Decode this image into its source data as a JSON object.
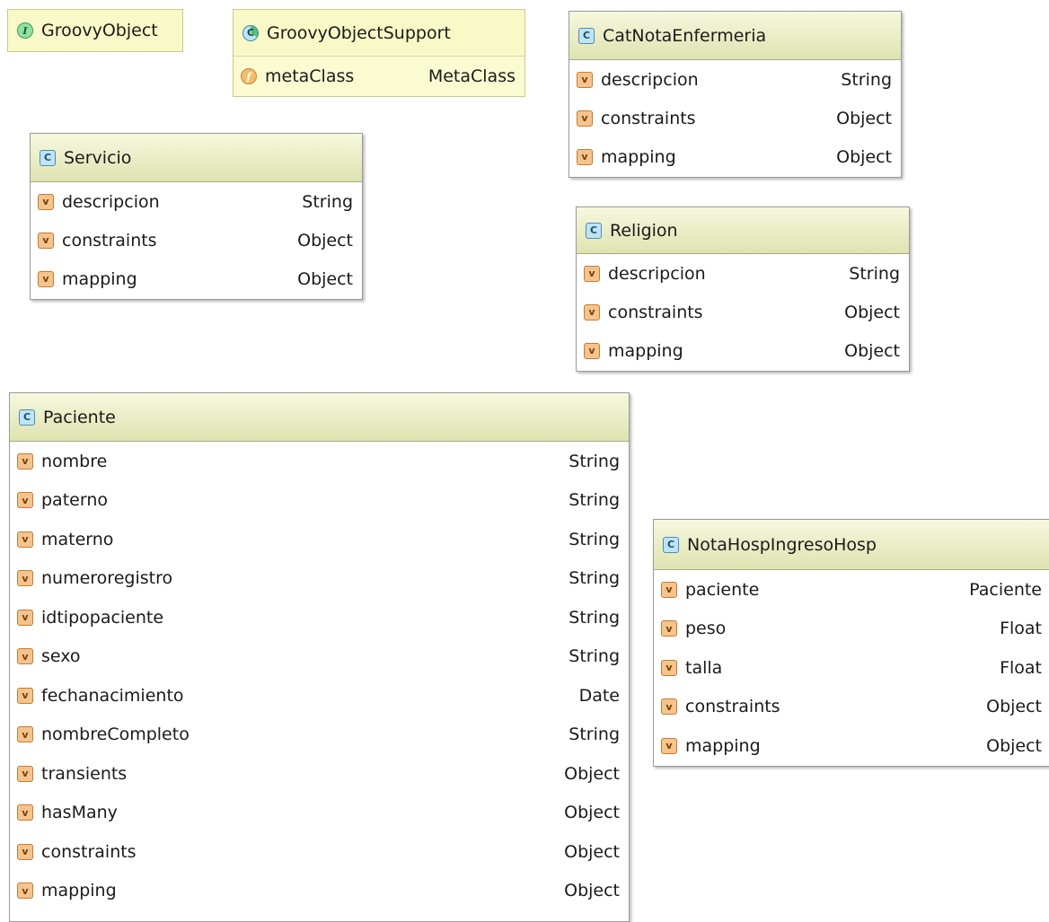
{
  "colors": {
    "header_top": "#f6f8df",
    "header_bottom": "#dfe3b0",
    "class_icon": "#bfe4f5",
    "field_icon": "#f4c48e",
    "interface_icon": "#8fe2a2",
    "yellow_box": "#fbfbd2"
  },
  "icons": {
    "class": "C",
    "field": "v",
    "interface": "I",
    "property": "f",
    "abstract_class": "C"
  },
  "boxes": {
    "groovyObject": {
      "name": "GroovyObject",
      "kind": "interface"
    },
    "groovyObjectSupport": {
      "name": "GroovyObjectSupport",
      "kind": "abstract-class",
      "fields": [
        {
          "name": "metaClass",
          "type": "MetaClass"
        }
      ]
    },
    "catNotaEnfermeria": {
      "name": "CatNotaEnfermeria",
      "fields": [
        {
          "name": "descripcion",
          "type": "String"
        },
        {
          "name": "constraints",
          "type": "Object"
        },
        {
          "name": "mapping",
          "type": "Object"
        }
      ]
    },
    "servicio": {
      "name": "Servicio",
      "fields": [
        {
          "name": "descripcion",
          "type": "String"
        },
        {
          "name": "constraints",
          "type": "Object"
        },
        {
          "name": "mapping",
          "type": "Object"
        }
      ]
    },
    "religion": {
      "name": "Religion",
      "fields": [
        {
          "name": "descripcion",
          "type": "String"
        },
        {
          "name": "constraints",
          "type": "Object"
        },
        {
          "name": "mapping",
          "type": "Object"
        }
      ]
    },
    "paciente": {
      "name": "Paciente",
      "fields": [
        {
          "name": "nombre",
          "type": "String"
        },
        {
          "name": "paterno",
          "type": "String"
        },
        {
          "name": "materno",
          "type": "String"
        },
        {
          "name": "numeroregistro",
          "type": "String"
        },
        {
          "name": "idtipopaciente",
          "type": "String"
        },
        {
          "name": "sexo",
          "type": "String"
        },
        {
          "name": "fechanacimiento",
          "type": "Date"
        },
        {
          "name": "nombreCompleto",
          "type": "String"
        },
        {
          "name": "transients",
          "type": "Object"
        },
        {
          "name": "hasMany",
          "type": "Object"
        },
        {
          "name": "constraints",
          "type": "Object"
        },
        {
          "name": "mapping",
          "type": "Object"
        }
      ]
    },
    "notaHosp": {
      "name": "NotaHospIngresoHosp",
      "fields": [
        {
          "name": "paciente",
          "type": "Paciente"
        },
        {
          "name": "peso",
          "type": "Float"
        },
        {
          "name": "talla",
          "type": "Float"
        },
        {
          "name": "constraints",
          "type": "Object"
        },
        {
          "name": "mapping",
          "type": "Object"
        }
      ]
    }
  }
}
